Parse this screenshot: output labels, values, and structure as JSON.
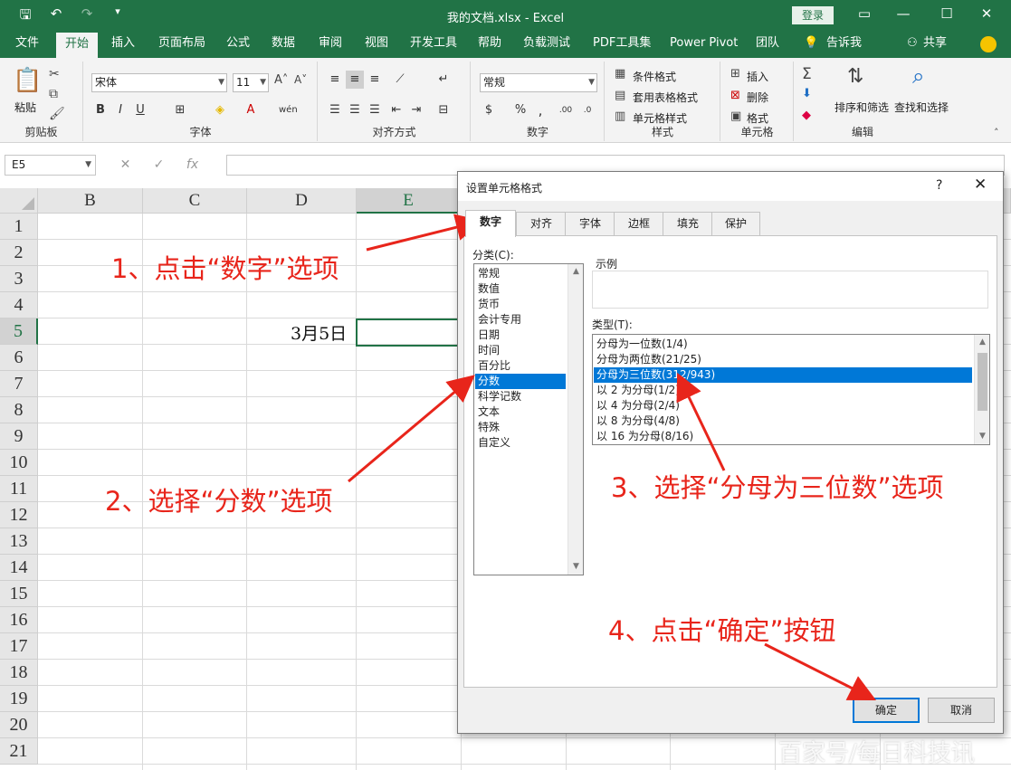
{
  "titlebar": {
    "title": "我的文档.xlsx  -  Excel",
    "login": "登录",
    "qat_icons": [
      "save-icon",
      "undo-icon",
      "redo-icon",
      "customize-icon"
    ]
  },
  "ribbon_tabs": {
    "file": "文件",
    "home": "开始",
    "insert": "插入",
    "page_layout": "页面布局",
    "formulas": "公式",
    "data": "数据",
    "review": "审阅",
    "view": "视图",
    "developer": "开发工具",
    "help": "帮助",
    "load_test": "负载测试",
    "pdf_tools": "PDF工具集",
    "power_pivot": "Power Pivot",
    "team": "团队",
    "tell_me": "告诉我",
    "share": "共享"
  },
  "ribbon": {
    "clipboard": {
      "paste": "粘贴",
      "label": "剪贴板"
    },
    "font": {
      "name": "宋体",
      "size": "11",
      "bold": "B",
      "italic": "I",
      "underline": "U",
      "label": "字体"
    },
    "alignment": {
      "label": "对齐方式"
    },
    "number": {
      "format": "常规",
      "percent": "%",
      "label": "数字"
    },
    "styles": {
      "conditional": "条件格式",
      "table_format": "套用表格格式",
      "cell_styles": "单元格样式",
      "label": "样式"
    },
    "cells": {
      "insert": "插入",
      "delete": "删除",
      "format": "格式",
      "label": "单元格"
    },
    "editing": {
      "sort_filter": "排序和筛选",
      "find_select": "查找和选择",
      "label": "编辑"
    }
  },
  "formula_bar": {
    "name_box": "E5",
    "fx": "fx",
    "cancel": "✕",
    "enter": "✓",
    "value": ""
  },
  "sheet": {
    "columns": [
      "B",
      "C",
      "D",
      "E"
    ],
    "rows": [
      "1",
      "2",
      "3",
      "4",
      "5",
      "6",
      "7",
      "8",
      "9",
      "10",
      "11",
      "12",
      "13",
      "14",
      "15",
      "16",
      "17",
      "18",
      "19",
      "20",
      "21"
    ],
    "cell_d5": "3月5日",
    "active_cell": "E5"
  },
  "dialog": {
    "title": "设置单元格格式",
    "help": "?",
    "close": "✕",
    "tabs": [
      "数字",
      "对齐",
      "字体",
      "边框",
      "填充",
      "保护"
    ],
    "category_label": "分类(C):",
    "categories": [
      "常规",
      "数值",
      "货币",
      "会计专用",
      "日期",
      "时间",
      "百分比",
      "分数",
      "科学记数",
      "文本",
      "特殊",
      "自定义"
    ],
    "selected_category": "分数",
    "sample_label": "示例",
    "type_label": "类型(T):",
    "types": [
      "分母为一位数(1/4)",
      "分母为两位数(21/25)",
      "分母为三位数(312/943)",
      "以 2 为分母(1/2)",
      "以 4 为分母(2/4)",
      "以 8 为分母(4/8)",
      "以 16 为分母(8/16)"
    ],
    "selected_type": "分母为三位数(312/943)",
    "ok": "确定",
    "cancel": "取消"
  },
  "annotations": {
    "step1": "1、点击“数字”选项",
    "step2": "2、选择“分数”选项",
    "step3": "3、选择“分母为三位数”选项",
    "step4": "4、点击“确定”按钮",
    "color": "#e8251b"
  },
  "watermark": "百家号/每日科技讯",
  "colors": {
    "excel_green": "#217346",
    "selection_blue": "#0078d7"
  }
}
